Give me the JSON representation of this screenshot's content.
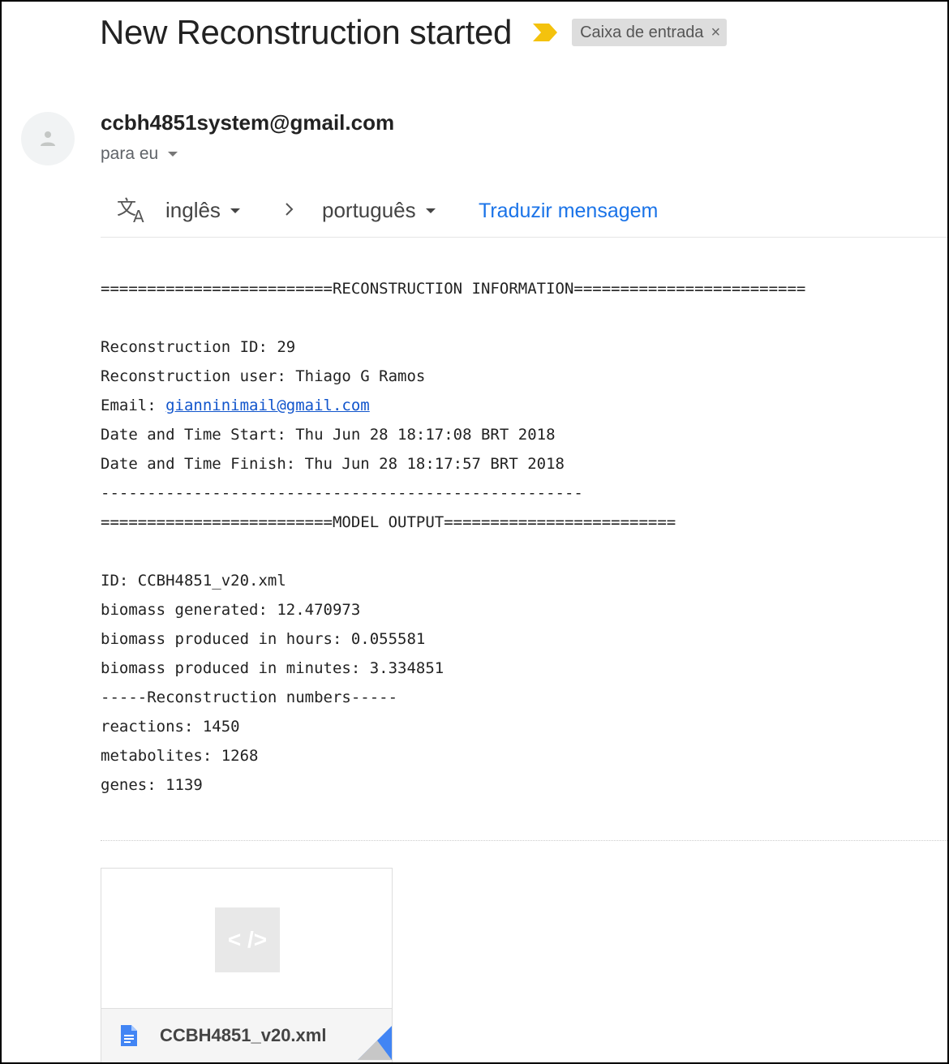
{
  "email": {
    "subject": "New Reconstruction started",
    "label": "Caixa de entrada",
    "label_remove": "×",
    "sender": "ccbh4851system@gmail.com",
    "recipient": "para eu"
  },
  "translate": {
    "from_lang": "inglês",
    "to_lang": "português",
    "action": "Traduzir mensagem"
  },
  "body": {
    "header1": "=========================RECONSTRUCTION INFORMATION=========================",
    "recon_id": "Reconstruction ID: 29",
    "recon_user": "Reconstruction user: Thiago G Ramos",
    "email_label": "Email: ",
    "email_link": "gianninimail@gmail.com",
    "start": "Date and Time Start: Thu Jun 28 18:17:08 BRT 2018",
    "finish": "Date and Time Finish: Thu Jun 28 18:17:57 BRT 2018",
    "divider": "----------------------------------------------------",
    "header2": "=========================MODEL OUTPUT=========================",
    "model_id": "ID: CCBH4851_v20.xml",
    "biomass_generated": "biomass generated: 12.470973",
    "biomass_hours": "biomass produced in hours: 0.055581",
    "biomass_minutes": "biomass produced in minutes: 3.334851",
    "numbers_header": "-----Reconstruction numbers-----",
    "reactions": "reactions: 1450",
    "metabolites": "metabolites: 1268",
    "genes": "genes: 1139"
  },
  "attachment": {
    "preview_glyph": "< />",
    "filename": "CCBH4851_v20.xml"
  },
  "icons": {
    "importance": "importance-marker-icon",
    "avatar": "person-icon",
    "translate": "translate-icon",
    "file": "document-icon"
  },
  "colors": {
    "importance": "#f4c20d",
    "link": "#1a73e8",
    "mail_link": "#1155cc",
    "file_icon": "#4285f4"
  }
}
